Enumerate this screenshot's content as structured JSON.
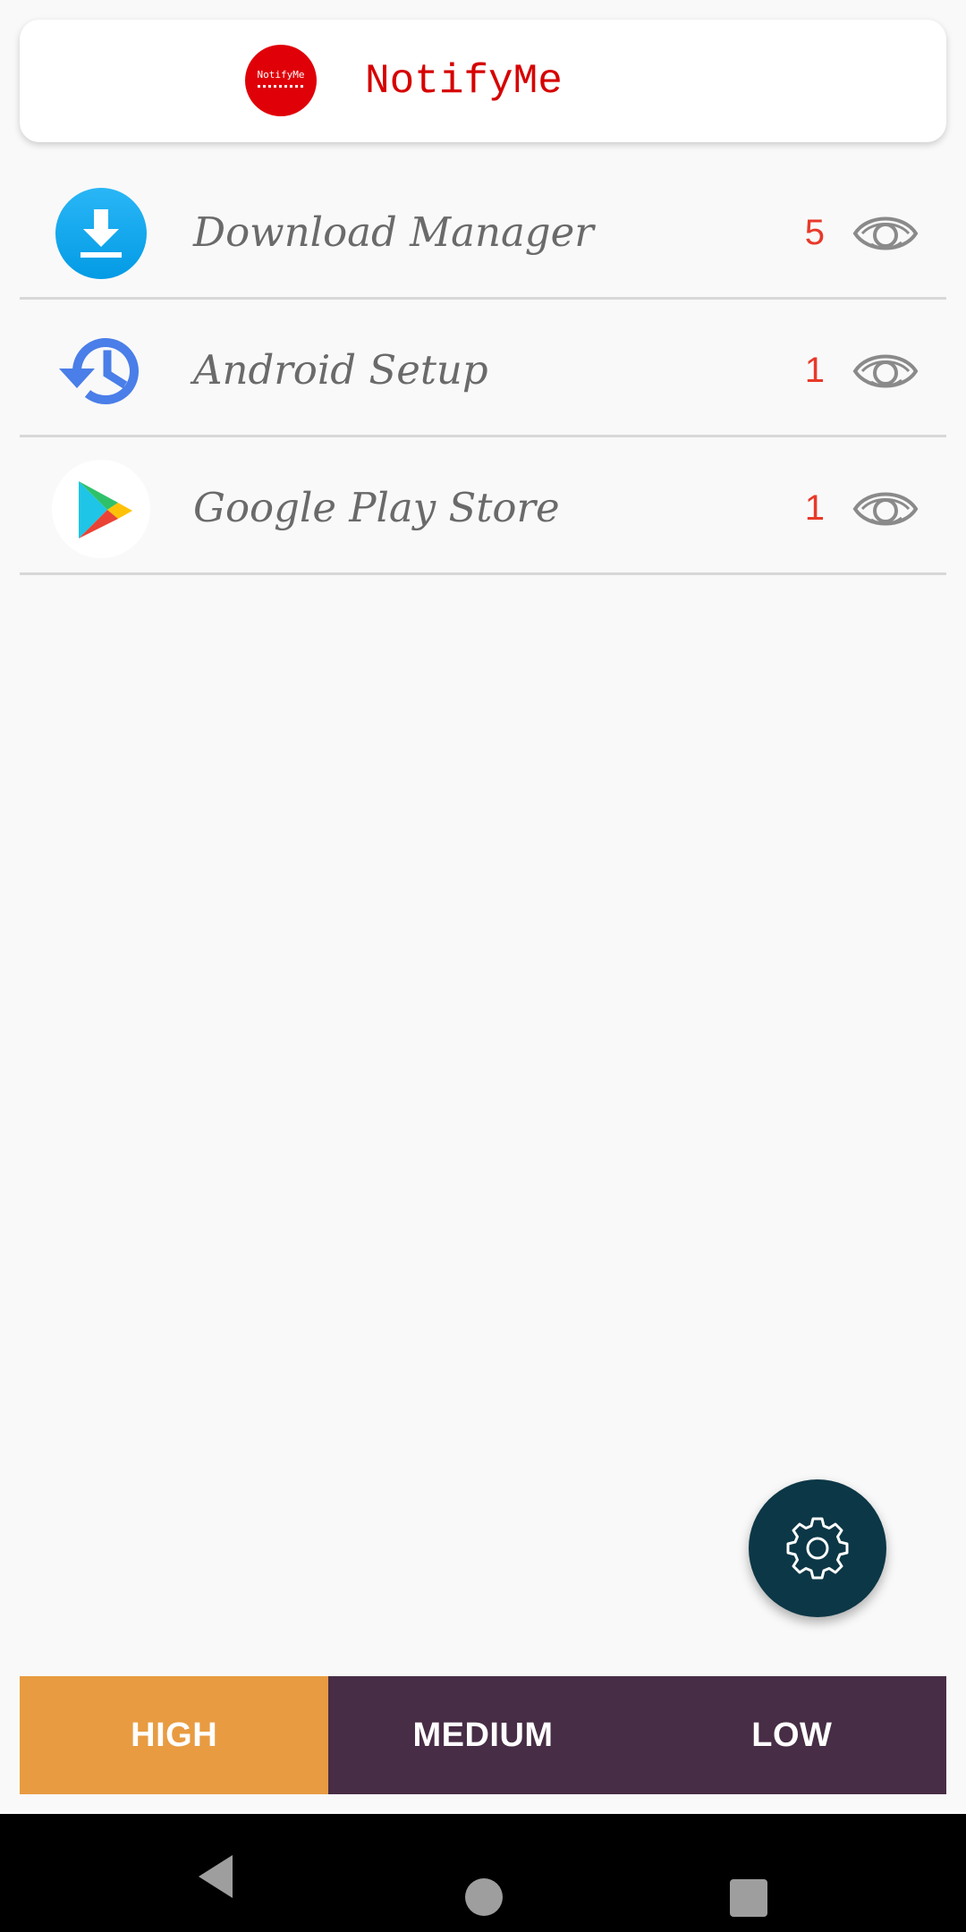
{
  "header": {
    "logo_text": "NotifyMe",
    "title": "NotifyMe"
  },
  "apps": [
    {
      "name": "Download Manager",
      "count": "5",
      "icon": "download-manager-icon"
    },
    {
      "name": "Android Setup",
      "count": "1",
      "icon": "history-icon"
    },
    {
      "name": "Google Play Store",
      "count": "1",
      "icon": "google-play-icon"
    }
  ],
  "fab": {
    "icon": "gear-icon"
  },
  "tabs": {
    "high": "HIGH",
    "medium": "MEDIUM",
    "low": "LOW",
    "active": "HIGH"
  },
  "nav": {
    "back": "back-icon",
    "home": "home-icon",
    "recent": "recent-apps-icon"
  },
  "colors": {
    "accent_red": "#d60000",
    "count_red": "#e8392a",
    "tab_active": "#e89b41",
    "tab_bar": "#472d45",
    "fab": "#0c3746"
  }
}
